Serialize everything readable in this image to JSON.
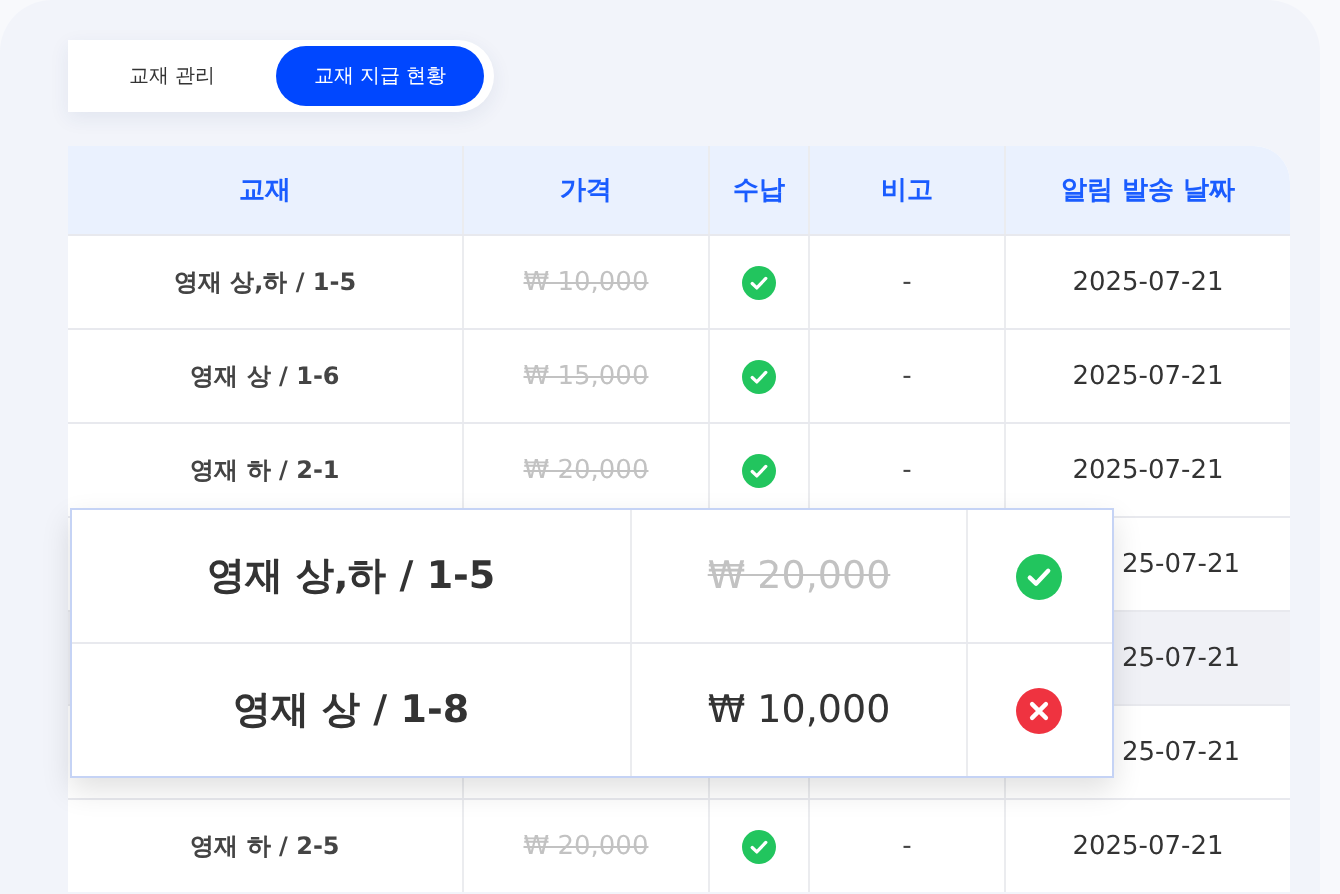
{
  "tabs": [
    {
      "label": "교재 관리",
      "selected": false
    },
    {
      "label": "교재 지급 현황",
      "selected": true
    }
  ],
  "table": {
    "columns": [
      "교재",
      "가격",
      "수납",
      "비고",
      "알림 발송 날짜"
    ],
    "rows": [
      {
        "kind": "full",
        "book": "영재 상,하 / 1-5",
        "price": "₩ 10,000",
        "paid": true,
        "note": "-",
        "date": "2025-07-21",
        "selected": false
      },
      {
        "kind": "full",
        "book": "영재 상 / 1-6",
        "price": "₩ 15,000",
        "paid": true,
        "note": "-",
        "date": "2025-07-21",
        "selected": false
      },
      {
        "kind": "full",
        "book": "영재 하 / 2-1",
        "price": "₩ 20,000",
        "paid": true,
        "note": "-",
        "date": "2025-07-21",
        "selected": false
      },
      {
        "kind": "covered",
        "date": "25-07-21",
        "selected": false
      },
      {
        "kind": "covered",
        "date": "25-07-21",
        "selected": true
      },
      {
        "kind": "covered",
        "date": "25-07-21",
        "selected": false
      },
      {
        "kind": "full",
        "book": "영재 하 / 2-5",
        "price": "₩ 20,000",
        "paid": true,
        "note": "-",
        "date": "2025-07-21",
        "selected": false
      }
    ]
  },
  "popup": {
    "rows": [
      {
        "book": "영재 상,하 / 1-5",
        "price": "₩ 20,000",
        "paid": true
      },
      {
        "book": "영재 상 / 1-8",
        "price": "₩ 10,000",
        "paid": false
      }
    ]
  }
}
